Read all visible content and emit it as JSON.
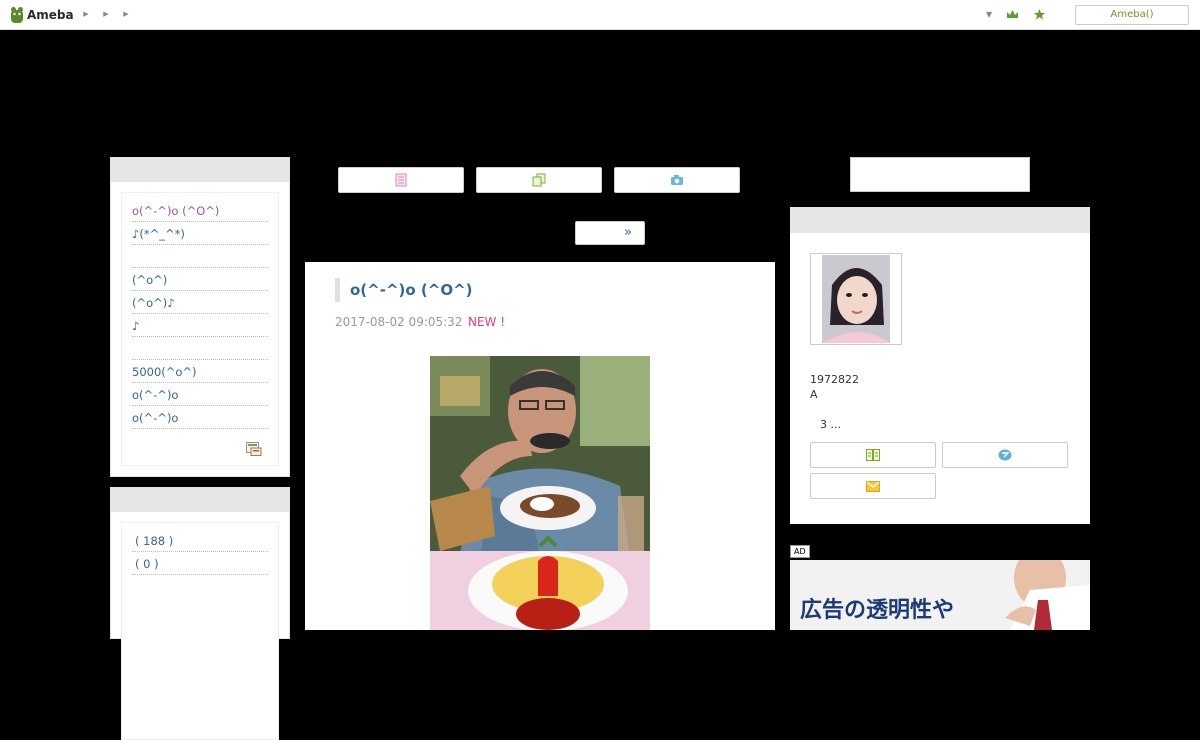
{
  "header": {
    "logo_text": "Ameba",
    "account_button": "Ameba()"
  },
  "sidebar_left": {
    "entries": [
      "o(^-^)o (^O^)",
      "♪(*^_^*)",
      "",
      "(^o^)",
      "(^o^)♪",
      "♪",
      "",
      "5000(^o^)",
      "o(^-^)o",
      "o(^-^)o"
    ],
    "archive": [
      "( 188 )",
      "( 0 )"
    ]
  },
  "nav": {
    "next_label": "»"
  },
  "article": {
    "title": "o(^-^)o (^O^)",
    "date": "2017-08-02 09:05:32",
    "new_badge": "NEW !"
  },
  "profile": {
    "id_text": "1972822",
    "sub_text": "A",
    "more_text": "3 ..."
  },
  "ad": {
    "tag": "AD",
    "banner_text": "広告の透明性や"
  },
  "colors": {
    "accent_link": "#336699",
    "new_badge": "#e63b7a",
    "ameba_green": "#6a9a2a"
  }
}
